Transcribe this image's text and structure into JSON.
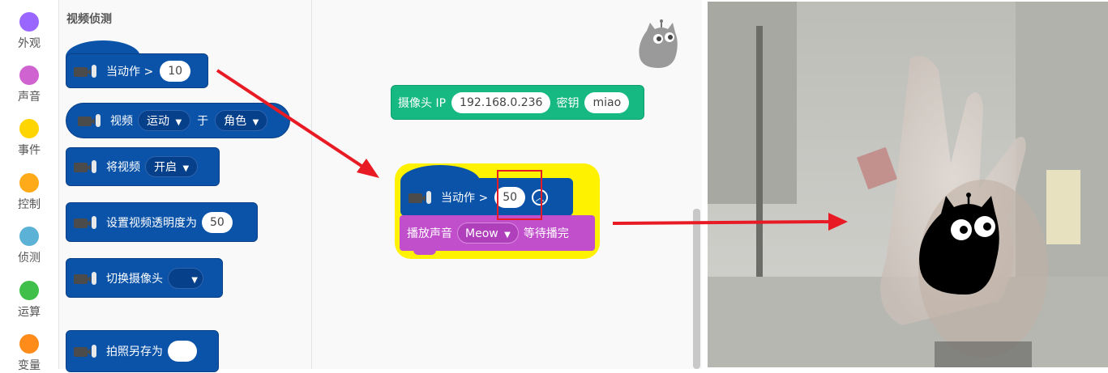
{
  "categories": [
    {
      "label": "外观",
      "color": "#9966ff"
    },
    {
      "label": "声音",
      "color": "#cf63cf"
    },
    {
      "label": "事件",
      "color": "#ffd500"
    },
    {
      "label": "控制",
      "color": "#ffab19"
    },
    {
      "label": "侦测",
      "color": "#5cb1d6"
    },
    {
      "label": "运算",
      "color": "#40bf4a"
    },
    {
      "label": "变量",
      "color": "#ff8c1a"
    }
  ],
  "palette": {
    "title": "视频侦测",
    "blocks": {
      "when_motion": {
        "text": "当动作 >",
        "value": "10"
      },
      "video_on": {
        "prefix": "视频",
        "attr": "运动",
        "mid": "于",
        "target": "角色"
      },
      "turn_video": {
        "text": "将视频",
        "option": "开启"
      },
      "set_transparency": {
        "text": "设置视频透明度为",
        "value": "50"
      },
      "switch_camera": {
        "text": "切换摄像头",
        "option": ""
      },
      "save_photo": {
        "text": "拍照另存为",
        "value": ""
      }
    }
  },
  "workspace": {
    "camera_ip": {
      "label": "摄像头 IP",
      "ip": "192.168.0.236",
      "key_label": "密钥",
      "key": "miao"
    },
    "motion_hat": {
      "text": "当动作 >",
      "value": "50"
    },
    "play_sound": {
      "text": "播放声音",
      "sound": "Meow",
      "suffix": "等待播完"
    }
  },
  "icons": {
    "camera": "video-camera-icon",
    "dropdown": "triangle-down-icon",
    "collapse": "chevron-up-circle-icon",
    "sprite": "cat-sprite-icon"
  },
  "colors": {
    "video_block": "#0a53a8",
    "extension_block": "#17b983",
    "sound_block": "#c14fcc",
    "highlight": "#fff200",
    "annotation": "#e81b24"
  }
}
